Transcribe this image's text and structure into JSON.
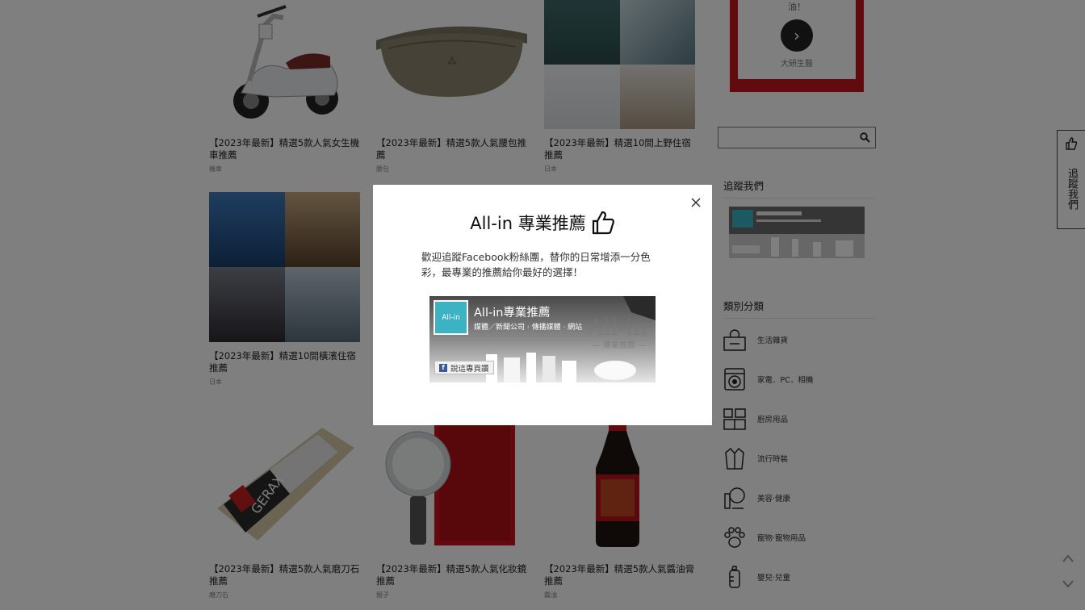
{
  "cards": [
    {
      "title": "【2023年最新】精選5款人氣女生機車推薦",
      "category": "機車"
    },
    {
      "title": "【2023年最新】精選5款人氣腰包推薦",
      "category": "腰包"
    },
    {
      "title": "【2023年最新】精選10間上野住宿推薦",
      "category": "日本"
    },
    {
      "title": "【2023年最新】精選10間橫濱住宿推薦",
      "category": "日本"
    },
    {
      "title": "【2023年最新】精選5款人氣磨刀石推薦",
      "category": "磨刀石"
    },
    {
      "title": "【2023年最新】精選5款人氣化妝鏡推薦",
      "category": "鏡子"
    },
    {
      "title": "【2023年最新】精選5款人氣醬油膏推薦",
      "category": "醬油"
    }
  ],
  "sidebar": {
    "promo_text": "油！",
    "promo_caption": "大研生醫",
    "search_placeholder": "",
    "follow_heading": "追蹤我們",
    "category_heading": "類別分類",
    "categories": [
      {
        "label": "生活雜貨",
        "icon": "tissue-box-icon"
      },
      {
        "label": "家電．PC．相機",
        "icon": "washing-machine-icon"
      },
      {
        "label": "廚房用品",
        "icon": "kitchen-icon"
      },
      {
        "label": "流行時裝",
        "icon": "coat-icon"
      },
      {
        "label": "美容‧健康",
        "icon": "cosmetics-icon"
      },
      {
        "label": "寵物‧寵物用品",
        "icon": "paw-icon"
      },
      {
        "label": "嬰兒‧兒童",
        "icon": "baby-bottle-icon"
      }
    ],
    "follow_tab": "追蹤我們"
  },
  "modal": {
    "title": "All-in 專業推薦",
    "description": "歡迎追蹤Facebook粉絲團，替你的日常增添一分色彩，最專業的推薦給你最好的選擇！",
    "fb_page_name": "All-in專業推薦",
    "fb_page_sub": "媒體／新聞公司 · 傳播媒體 · 網站",
    "fb_logo_text": "All-in",
    "fb_like_label": "說這專頁讚",
    "fb_watermark": "All-in",
    "fb_watermark_sub": "— 專業推薦 —"
  },
  "colors": {
    "overlay": "#000000",
    "promo_red": "#c4161c",
    "fb_blue": "#3b5998",
    "brand_teal": "#3bb3c3"
  }
}
